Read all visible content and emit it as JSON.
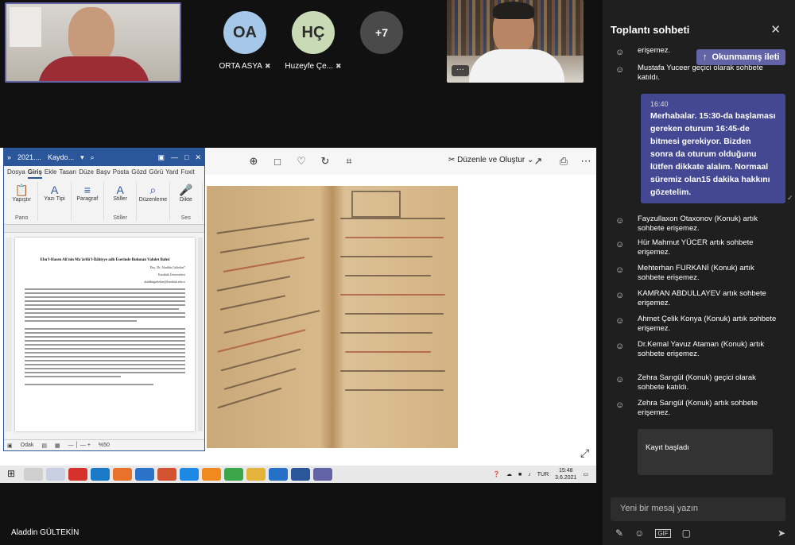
{
  "participants": [
    {
      "initials": "OA",
      "name": "ORTA ASYA",
      "color": "#a6c8e8"
    },
    {
      "initials": "HÇ",
      "name": "Huzeyfe Çe...",
      "color": "#c8dbb6"
    },
    {
      "initials": "+7",
      "name": "",
      "color": "#4a4a4a"
    }
  ],
  "tile_right_more": "···",
  "presenter_name": "Aladdin GÜLTEKİN",
  "photo_viewer": {
    "edit_create": "Düzenle ve Oluştur"
  },
  "word": {
    "title": "2021....",
    "title_status": "Kaydo...",
    "tabs": [
      "Dosya",
      "Giriş",
      "Ekle",
      "Tasarı",
      "Düze",
      "Başv",
      "Posta",
      "Gözd",
      "Görü",
      "Yard",
      "Foxit"
    ],
    "active_tab": "Giriş",
    "ribbon": [
      {
        "label": "Yapıştır",
        "group": "Pano"
      },
      {
        "label": "Yazı Tipi",
        "group": ""
      },
      {
        "label": "Paragraf",
        "group": ""
      },
      {
        "label": "Stiller",
        "group": "Stiller"
      },
      {
        "label": "Düzenleme",
        "group": ""
      },
      {
        "label": "Dikte",
        "group": "Ses"
      }
    ],
    "doc_title": "Ebu'l-Hasen Ali'nin Ma'ârifü'l-İlâhiyye adlı Eserinde Bulunan Vahdet Bahsi",
    "doc_meta": [
      "Doç. Dr. Aladdin Gültekin*",
      "Karabük Üniversitesi",
      "aladdingultekin@karabuk.edu.tr"
    ],
    "status_focus": "Odak",
    "status_zoom": "%50"
  },
  "taskbar": {
    "lang": "TUR",
    "time": "15:48",
    "date": "3.6.2021"
  },
  "chat": {
    "header": "Toplantı sohbeti",
    "unread_button": "Okunmamış ileti",
    "top_items": [
      {
        "text": "erişemez.",
        "icon": "person-remove-icon"
      },
      {
        "text": "Mustafa Yuceer geçici olarak sohbete katıldı.",
        "icon": "person-add-icon"
      }
    ],
    "message": {
      "time": "16:40",
      "text": "Merhabalar. 15:30-da başlaması gereken oturum 16:45-de bitmesi gerekiyor. Bizden sonra da oturum olduğunu lütfen dikkate alalım. Normaal süremiz olan15 dakika hakkını gözetelim."
    },
    "items": [
      {
        "text": "Fayzullaxon Otaxonov (Konuk) artık sohbete erişemez.",
        "icon": "person-remove-icon"
      },
      {
        "text": "Hür Mahmut YÜCER artık sohbete erişemez.",
        "icon": "person-remove-icon"
      },
      {
        "text": "Mehterhan FURKANİ (Konuk) artık sohbete erişemez.",
        "icon": "person-remove-icon"
      },
      {
        "text": "KAMRAN ABDULLAYEV artık sohbete erişemez.",
        "icon": "person-remove-icon"
      },
      {
        "text": "Ahmet Çelik Konya (Konuk) artık sohbete erişemez.",
        "icon": "person-remove-icon"
      },
      {
        "text": "Dr.Kemal Yavuz Ataman (Konuk) artık sohbete erişemez.",
        "icon": "person-remove-icon"
      },
      {
        "text": "Zehra Sarıgül (Konuk) geçici olarak sohbete katıldı.",
        "icon": "person-add-icon"
      },
      {
        "text": "Zehra Sarıgül (Konuk) artık sohbete erişemez.",
        "icon": "person-remove-icon"
      }
    ],
    "recording": "Kayıt başladı",
    "compose_placeholder": "Yeni bir mesaj yazın",
    "accent": "#6264a7"
  }
}
